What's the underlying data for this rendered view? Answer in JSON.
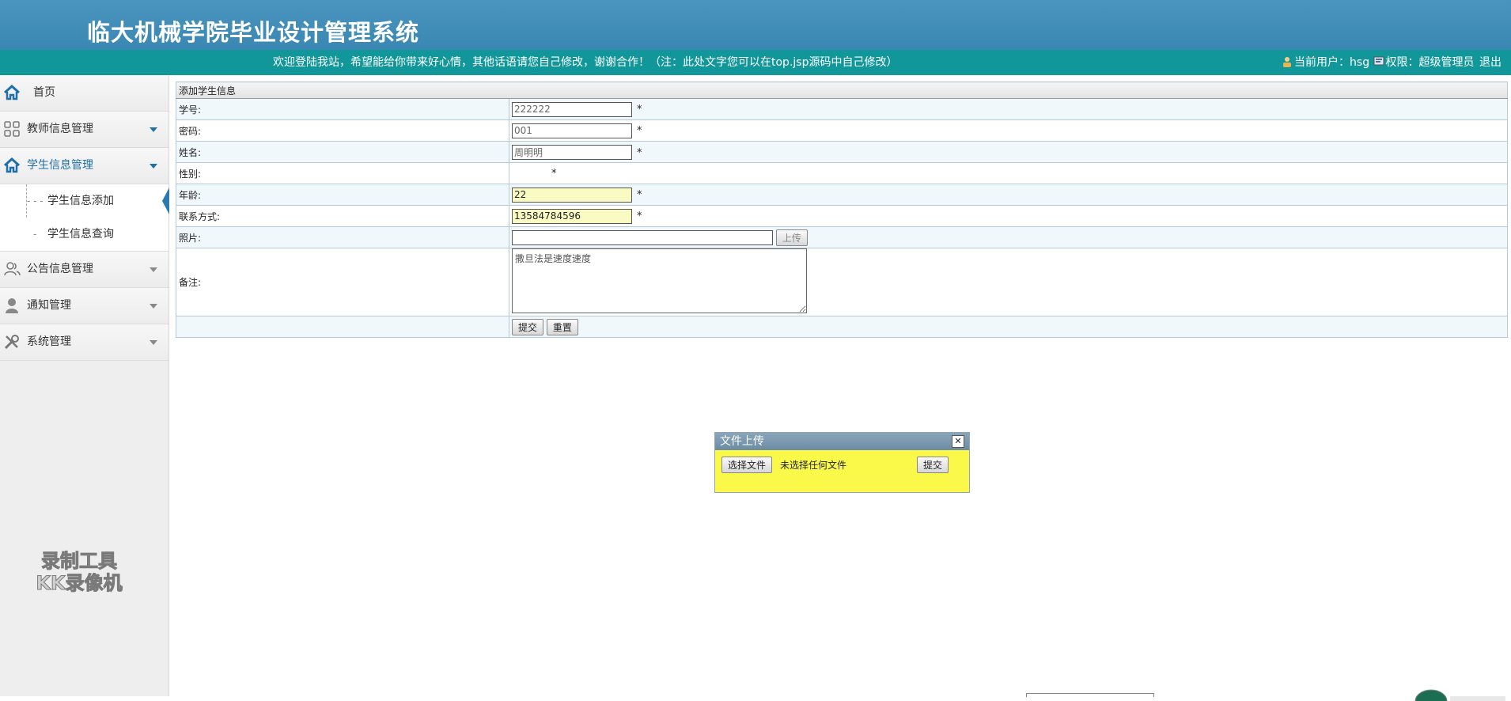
{
  "header": {
    "title": "临大机械学院毕业设计管理系统"
  },
  "infobar": {
    "welcome": "欢迎登陆我站，希望能给你带来好心情，其他话语请您自己修改，谢谢合作！（注：此处文字您可以在top.jsp源码中自己修改）",
    "current_user": "当前用户：hsg",
    "permission": "权限：超级管理员",
    "logout": "退出"
  },
  "sidebar": {
    "items": [
      {
        "label": "首页",
        "icon": "home-icon"
      },
      {
        "label": "教师信息管理",
        "icon": "grid-icon"
      },
      {
        "label": "学生信息管理",
        "icon": "home-icon",
        "active": true
      },
      {
        "label": "公告信息管理",
        "icon": "users-icon"
      },
      {
        "label": "通知管理",
        "icon": "user-icon"
      },
      {
        "label": "系统管理",
        "icon": "tools-icon"
      }
    ],
    "submenu": [
      {
        "label": "学生信息添加",
        "current": true
      },
      {
        "label": "学生信息查询"
      }
    ]
  },
  "watermark": {
    "line1": "录制工具",
    "line2": "KK录像机"
  },
  "form": {
    "section_title": "添加学生信息",
    "required_mark": "*",
    "fields": {
      "student_id": {
        "label": "学号:",
        "value": "222222"
      },
      "password": {
        "label": "密码:",
        "value": "001"
      },
      "name": {
        "label": "姓名:",
        "value": "周明明"
      },
      "gender": {
        "label": "性别:"
      },
      "age": {
        "label": "年龄:",
        "value": "22"
      },
      "contact": {
        "label": "联系方式:",
        "value": "13584784596"
      },
      "photo": {
        "label": "照片:",
        "value": "",
        "upload_button": "上传"
      },
      "remarks": {
        "label": "备注:",
        "value": "撒旦法是速度速度"
      }
    },
    "submit_label": "提交",
    "reset_label": "重置"
  },
  "upload_dialog": {
    "title": "文件上传",
    "close": "✕",
    "choose_label": "选择文件",
    "no_file_text": "未选择任何文件",
    "submit_label": "提交"
  },
  "colors": {
    "header_bg": "#3a87b3",
    "infobar_bg": "#11979a",
    "sidebar_bg": "#eeeeee",
    "accent": "#1f6fa8",
    "dialog_bg": "#faf94a",
    "highlight_input": "#fafbc3"
  }
}
